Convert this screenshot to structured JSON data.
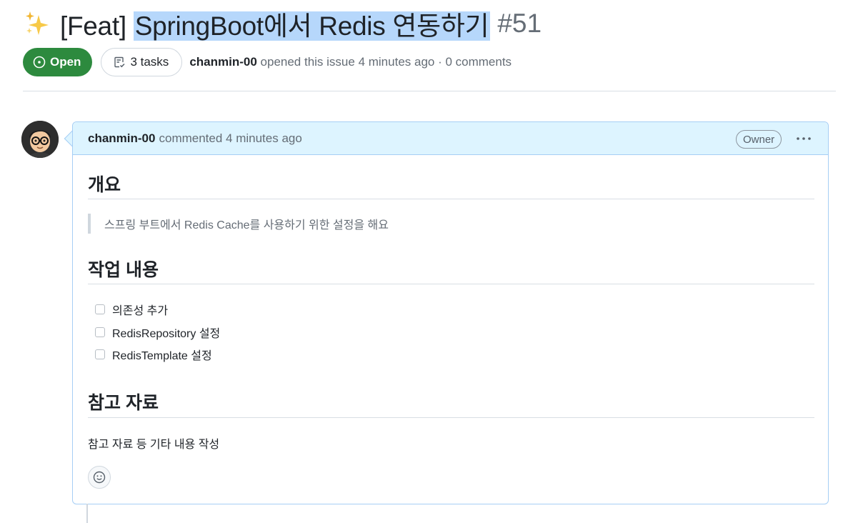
{
  "issue": {
    "emoji_icon": "sparkles-icon",
    "title_prefix": "[Feat] ",
    "title_selected": "SpringBoot에서 Redis 연동하기",
    "number": "#51",
    "state": "Open",
    "tasks_label": "3 tasks",
    "author": "chanmin-00",
    "opened_text": "opened this issue 4 minutes ago · 0 comments",
    "colors": {
      "open_green": "#2d8a3e",
      "selection": "#b6d7fb",
      "comment_header": "#ddf4ff",
      "comment_border": "#a6cef5"
    }
  },
  "comment": {
    "author": "chanmin-00",
    "meta": "commented 4 minutes ago",
    "role_badge": "Owner",
    "menu_icon": "kebab-horizontal-icon",
    "reaction_icon": "smiley-icon",
    "sections": {
      "overview_heading": "개요",
      "overview_quote": "스프링 부트에서 Redis Cache를 사용하기 위한 설정을 해요",
      "tasks_heading": "작업 내용",
      "tasks": [
        {
          "label": "의존성 추가",
          "checked": false
        },
        {
          "label": "RedisRepository 설정",
          "checked": false
        },
        {
          "label": "RedisTemplate 설정",
          "checked": false
        }
      ],
      "refs_heading": "참고 자료",
      "refs_text": "참고 자료 등 기타 내용 작성"
    }
  }
}
